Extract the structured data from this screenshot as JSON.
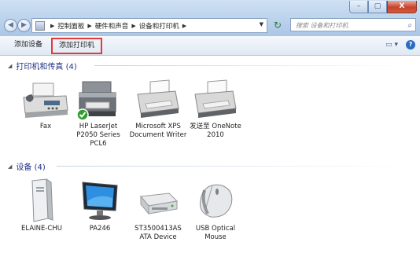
{
  "window": {
    "buttons": [
      "–",
      "▢",
      "X"
    ]
  },
  "address": {
    "crumbs": [
      "控制面板",
      "硬件和声音",
      "设备和打印机"
    ],
    "search_placeholder": "搜索 设备和打印机"
  },
  "commands": {
    "add_device": "添加设备",
    "add_printer": "添加打印机"
  },
  "groups": {
    "printers": {
      "header": "打印机和传真 (4)",
      "items": [
        {
          "label": "Fax",
          "icon": "fax-icon"
        },
        {
          "label": "HP LaserJet P2050 Series PCL6",
          "icon": "printer-default-icon"
        },
        {
          "label": "Microsoft XPS Document Writer",
          "icon": "printer-icon"
        },
        {
          "label": "发送至 OneNote 2010",
          "icon": "printer-icon"
        }
      ]
    },
    "devices": {
      "header": "设备 (4)",
      "items": [
        {
          "label": "ELAINE-CHU",
          "icon": "computer-tower-icon"
        },
        {
          "label": "PA246",
          "icon": "monitor-icon"
        },
        {
          "label": "ST3500413AS ATA Device",
          "icon": "hard-drive-icon"
        },
        {
          "label": "USB Optical Mouse",
          "icon": "mouse-icon"
        }
      ]
    }
  },
  "colors": {
    "header_blue": "#1e3287",
    "highlight_red": "#e23a3a",
    "default_check_green": "#2f9e2f"
  }
}
